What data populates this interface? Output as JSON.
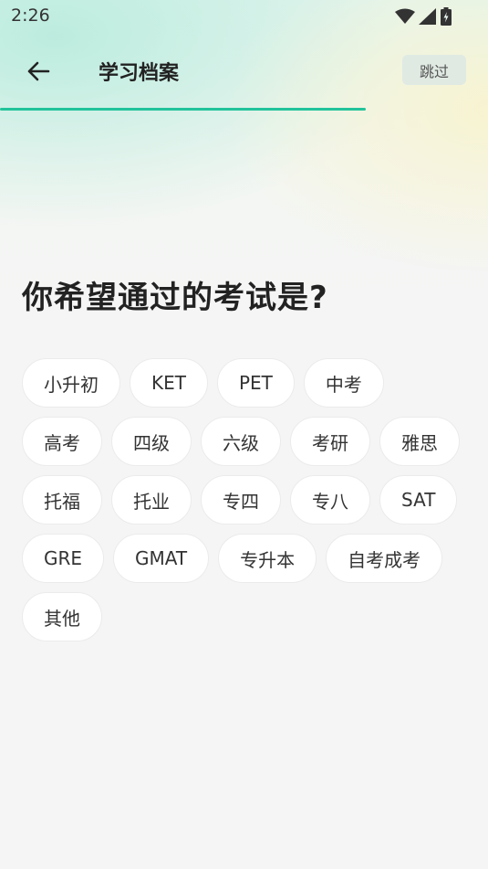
{
  "status_bar": {
    "time": "2:26"
  },
  "header": {
    "title": "学习档案",
    "skip_label": "跳过"
  },
  "progress": {
    "value": 0.75
  },
  "question": "你希望通过的考试是?",
  "options": [
    "小升初",
    "KET",
    "PET",
    "中考",
    "高考",
    "四级",
    "六级",
    "考研",
    "雅思",
    "托福",
    "托业",
    "专四",
    "专八",
    "SAT",
    "GRE",
    "GMAT",
    "专升本",
    "自考成考",
    "其他"
  ],
  "colors": {
    "accent": "#22c39b",
    "chip_bg": "#ffffff",
    "text": "#222222"
  }
}
